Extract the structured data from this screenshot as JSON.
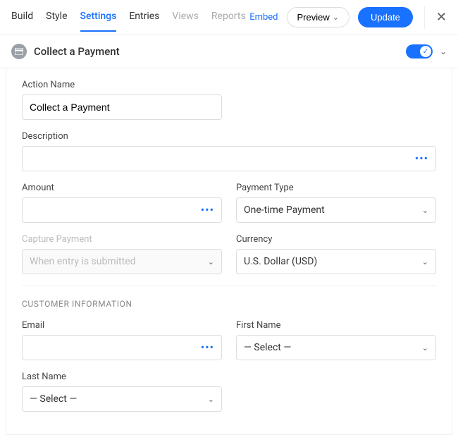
{
  "nav": {
    "tabs": {
      "build": "Build",
      "style": "Style",
      "settings": "Settings",
      "entries": "Entries",
      "views": "Views",
      "reports": "Reports"
    },
    "embed": "Embed",
    "preview": "Preview",
    "update": "Update"
  },
  "section": {
    "title": "Collect a Payment"
  },
  "fields": {
    "actionName": {
      "label": "Action Name",
      "value": "Collect a Payment"
    },
    "description": {
      "label": "Description",
      "value": ""
    },
    "amount": {
      "label": "Amount",
      "value": ""
    },
    "paymentType": {
      "label": "Payment Type",
      "value": "One-time Payment"
    },
    "capturePayment": {
      "label": "Capture Payment",
      "value": "When entry is submitted"
    },
    "currency": {
      "label": "Currency",
      "value": "U.S. Dollar (USD)"
    }
  },
  "customer": {
    "header": "CUSTOMER INFORMATION",
    "email": {
      "label": "Email",
      "value": ""
    },
    "firstName": {
      "label": "First Name",
      "value": "— Select —"
    },
    "lastName": {
      "label": "Last Name",
      "value": "— Select —"
    }
  }
}
